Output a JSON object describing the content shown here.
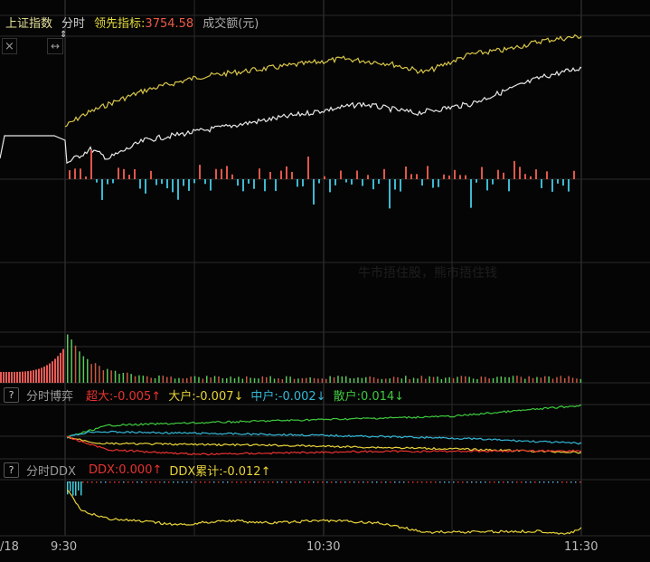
{
  "header": {
    "index_name": "上证指数",
    "mode": "分时",
    "leader_label": "领先指标:",
    "leader_value": "3754.58",
    "volume_label": "成交额(元)"
  },
  "controls": {
    "close_icon": "×",
    "expand_icon": "↔",
    "resize_icon": "⇕"
  },
  "watermark": "牛市捂住股，熊市捂住钱",
  "game_panel": {
    "help": "?",
    "title": "分时博弈",
    "items": [
      {
        "label": "超大:-0.005↑",
        "color": "#e8322f"
      },
      {
        "label": "大户:-0.007↓",
        "color": "#e8d33a"
      },
      {
        "label": "中户:-0.002↓",
        "color": "#34b7d6"
      },
      {
        "label": "散户:0.014↓",
        "color": "#3ec93e"
      }
    ]
  },
  "ddx_panel": {
    "help": "?",
    "title": "分时DDX",
    "items": [
      {
        "label": "DDX:0.000↑",
        "color": "#e8322f"
      },
      {
        "label": "DDX累计:-0.012↑",
        "color": "#e8d33a"
      }
    ]
  },
  "time_axis": [
    "/18",
    "9:30",
    "10:30",
    "11:30"
  ],
  "colors": {
    "up": "#e0574a",
    "down": "#3db8d0",
    "leader": "#d8c64a",
    "index": "#e8e8e8"
  }
}
